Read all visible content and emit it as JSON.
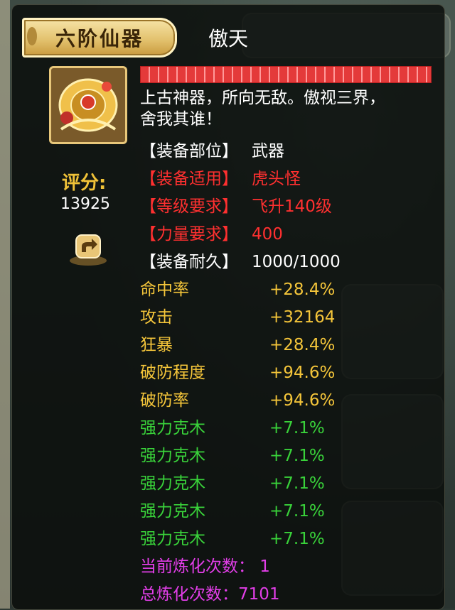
{
  "tooltip": {
    "tier_label": "六阶仙器",
    "item_name": "傲天",
    "description": "上古神器，所向无敌。傲视三界，舍我其谁！",
    "score_label": "评分:",
    "score_value": "13925"
  },
  "requirements": [
    {
      "label": "【装备部位】",
      "value": "武器",
      "color": "#ffffff"
    },
    {
      "label": "【装备适用】",
      "value": "虎头怪",
      "color": "#ff3030"
    },
    {
      "label": "【等级要求】",
      "value": "飞升140级",
      "color": "#ff3030"
    },
    {
      "label": "【力量要求】",
      "value": "400",
      "color": "#ff3030"
    },
    {
      "label": "【装备耐久】",
      "value": "1000/1000",
      "color": "#ffffff"
    }
  ],
  "attributes": [
    {
      "label": "命中率",
      "value": "+28.4%",
      "color": "#f4c53a"
    },
    {
      "label": "攻击",
      "value": "+32164",
      "color": "#f4c53a"
    },
    {
      "label": "狂暴",
      "value": "+28.4%",
      "color": "#f4c53a"
    },
    {
      "label": "破防程度",
      "value": "+94.6%",
      "color": "#f4c53a"
    },
    {
      "label": "破防率",
      "value": "+94.6%",
      "color": "#f4c53a"
    },
    {
      "label": "强力克木",
      "value": "+7.1%",
      "color": "#39d23a"
    },
    {
      "label": "强力克木",
      "value": "+7.1%",
      "color": "#39d23a"
    },
    {
      "label": "强力克木",
      "value": "+7.1%",
      "color": "#39d23a"
    },
    {
      "label": "强力克木",
      "value": "+7.1%",
      "color": "#39d23a"
    },
    {
      "label": "强力克木",
      "value": "+7.1%",
      "color": "#39d23a"
    }
  ],
  "refine": [
    {
      "text": "当前炼化次数： 1",
      "color": "#e23ee8"
    },
    {
      "text": "总炼化次数：7101",
      "color": "#e23ee8"
    }
  ],
  "icons": {
    "item": "golden-weapon-icon",
    "share": "share-arrow-icon",
    "durability": "durability-bar"
  }
}
